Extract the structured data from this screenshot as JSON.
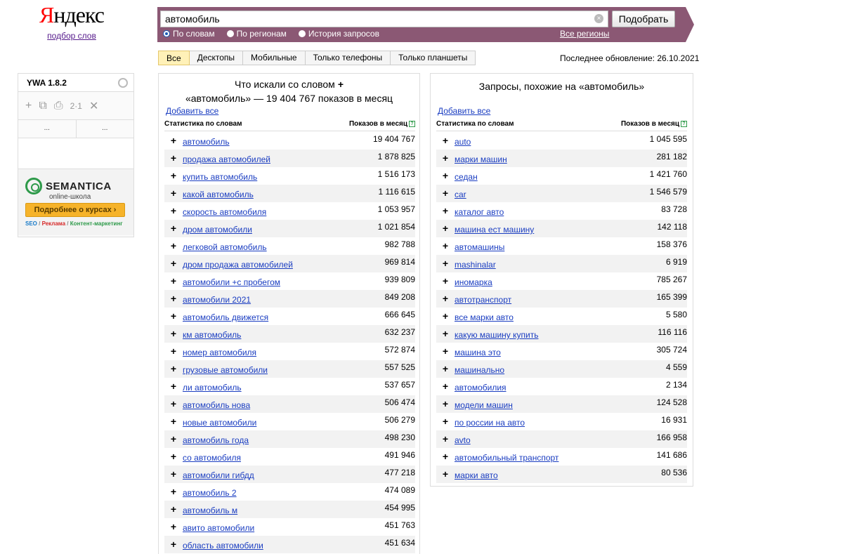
{
  "logo": {
    "title_first": "Я",
    "title_rest": "ндекс",
    "subtitle": "подбор слов"
  },
  "search": {
    "value": "автомобиль",
    "clear_icon": "×",
    "submit_label": "Подобрать",
    "modes": [
      "По словам",
      "По регионам",
      "История запросов"
    ],
    "all_regions": "Все регионы"
  },
  "tabs": [
    "Все",
    "Десктопы",
    "Мобильные",
    "Только телефоны",
    "Только планшеты"
  ],
  "last_update": "Последнее обновление: 26.10.2021",
  "ywa": {
    "title": "YWA 1.8.2",
    "tools": [
      "+",
      "⧉",
      "⎙",
      "2·1",
      "✕"
    ],
    "dots": [
      "...",
      "..."
    ],
    "ad": {
      "brand": "SEMANTICA",
      "brand_sub": "online-школа",
      "button": "Подробнее о курсах ›",
      "tag_seo": "SEO",
      "tag_ads": "Реклама",
      "tag_content": "Контент-маркетинг",
      "sep": " / "
    }
  },
  "left_panel": {
    "title_line1": "Что искали со словом",
    "title_line2": "«автомобиль» — 19 404 767 показов в месяц",
    "plus": "+",
    "add_all": "Добавить все",
    "col_phrase": "Статистика по словам",
    "col_count": "Показов в месяц",
    "help": "?",
    "rows": [
      {
        "phrase": "автомобиль",
        "count": "19 404 767"
      },
      {
        "phrase": "продажа автомобилей",
        "count": "1 878 825"
      },
      {
        "phrase": "купить автомобиль",
        "count": "1 516 173"
      },
      {
        "phrase": "какой автомобиль",
        "count": "1 116 615"
      },
      {
        "phrase": "скорость автомобиля",
        "count": "1 053 957"
      },
      {
        "phrase": "дром автомобили",
        "count": "1 021 854"
      },
      {
        "phrase": "легковой автомобиль",
        "count": "982 788"
      },
      {
        "phrase": "дром продажа автомобилей",
        "count": "969 814"
      },
      {
        "phrase": "автомобили +с пробегом",
        "count": "939 809"
      },
      {
        "phrase": "автомобили 2021",
        "count": "849 208"
      },
      {
        "phrase": "автомобиль движется",
        "count": "666 645"
      },
      {
        "phrase": "км автомобиль",
        "count": "632 237"
      },
      {
        "phrase": "номер автомобиля",
        "count": "572 874"
      },
      {
        "phrase": "грузовые автомобили",
        "count": "557 525"
      },
      {
        "phrase": "ли автомобиль",
        "count": "537 657"
      },
      {
        "phrase": "автомобиль нова",
        "count": "506 474"
      },
      {
        "phrase": "новые автомобили",
        "count": "506 279"
      },
      {
        "phrase": "автомобиль года",
        "count": "498 230"
      },
      {
        "phrase": "со автомобиля",
        "count": "491 946"
      },
      {
        "phrase": "автомобили гибдд",
        "count": "477 218"
      },
      {
        "phrase": "автомобиль 2",
        "count": "474 089"
      },
      {
        "phrase": "автомобиль м",
        "count": "454 995"
      },
      {
        "phrase": "авито автомобили",
        "count": "451 763"
      },
      {
        "phrase": "область автомобили",
        "count": "451 634"
      }
    ]
  },
  "right_panel": {
    "title": "Запросы, похожие на «автомобиль»",
    "add_all": "Добавить все",
    "col_phrase": "Статистика по словам",
    "col_count": "Показов в месяц",
    "help": "?",
    "rows": [
      {
        "phrase": "auto",
        "count": "1 045 595"
      },
      {
        "phrase": "марки машин",
        "count": "281 182"
      },
      {
        "phrase": "седан",
        "count": "1 421 760"
      },
      {
        "phrase": "car",
        "count": "1 546 579"
      },
      {
        "phrase": "каталог авто",
        "count": "83 728"
      },
      {
        "phrase": "машина ест машину",
        "count": "142 118"
      },
      {
        "phrase": "автомашины",
        "count": "158 376"
      },
      {
        "phrase": "mashinalar",
        "count": "6 919"
      },
      {
        "phrase": "иномарка",
        "count": "785 267"
      },
      {
        "phrase": "автотранспорт",
        "count": "165 399"
      },
      {
        "phrase": "все марки авто",
        "count": "5 580"
      },
      {
        "phrase": "какую машину купить",
        "count": "116 116"
      },
      {
        "phrase": "машина это",
        "count": "305 724"
      },
      {
        "phrase": "машинально",
        "count": "4 559"
      },
      {
        "phrase": "автомобилия",
        "count": "2 134"
      },
      {
        "phrase": "модели машин",
        "count": "124 528"
      },
      {
        "phrase": "по россии на авто",
        "count": "16 931"
      },
      {
        "phrase": "avto",
        "count": "166 958"
      },
      {
        "phrase": "автомобильный транспорт",
        "count": "141 686"
      },
      {
        "phrase": "марки авто",
        "count": "80 536"
      }
    ]
  },
  "row_plus": "+"
}
